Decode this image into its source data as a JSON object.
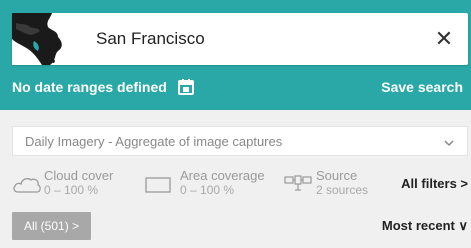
{
  "search": {
    "location": "San Francisco",
    "clear_icon": "close-icon",
    "clear_glyph": "✕"
  },
  "dates": {
    "label": "No date ranges defined",
    "icon": "calendar-icon"
  },
  "save_search_label": "Save search",
  "layer": {
    "selected": "Daily Imagery - Aggregate of image captures",
    "icon": "chevron-down-icon"
  },
  "filters": {
    "cloud": {
      "title": "Cloud cover",
      "value": "0 – 100 %",
      "icon": "cloud-icon"
    },
    "area": {
      "title": "Area coverage",
      "value": "0 – 100 %",
      "icon": "area-icon"
    },
    "source": {
      "title": "Source",
      "value": "2 sources",
      "icon": "satellite-icon"
    },
    "all_label": "All filters >"
  },
  "results": {
    "count_label": "All (501) >",
    "sort_label": "Most recent ∨"
  },
  "colors": {
    "teal": "#2aa8a8",
    "panel": "#f0f0f0",
    "badge": "#a8a8a8"
  }
}
